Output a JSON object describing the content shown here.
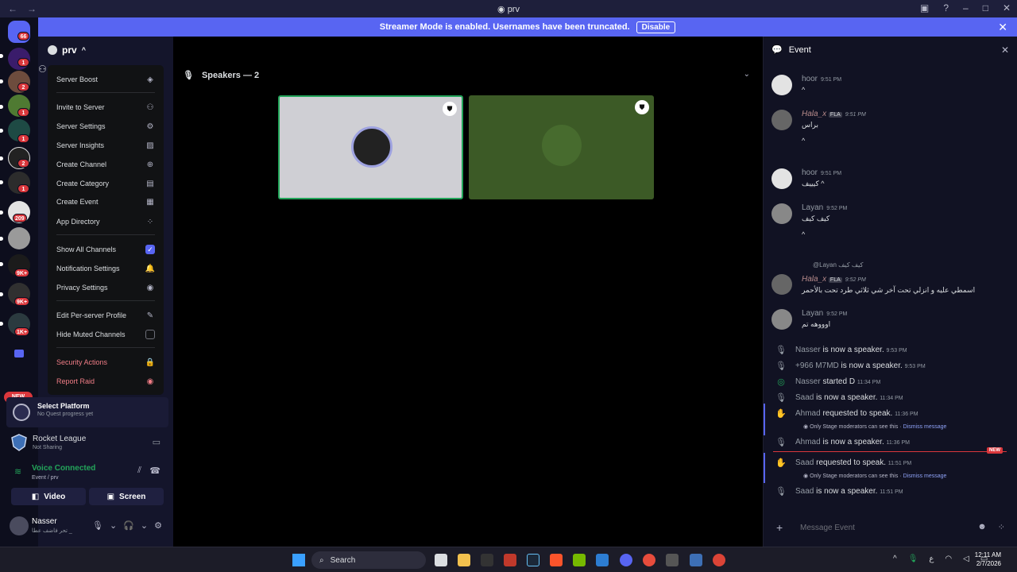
{
  "window": {
    "title": "prv",
    "back": "←",
    "forward": "→",
    "controls": [
      "▣",
      "?",
      "–",
      "□",
      "✕"
    ]
  },
  "server_rail": {
    "badges": [
      "66",
      "1",
      "2",
      "1",
      "1",
      "2",
      "1",
      "209",
      "9K+",
      "9K+",
      "1K+"
    ],
    "new_label": "NEW"
  },
  "banner": {
    "text": "Streamer Mode is enabled. Usernames have been truncated.",
    "button": "Disable",
    "close": "✕"
  },
  "sidebar": {
    "server_name": "prv",
    "menu": {
      "items": [
        {
          "label": "Server Boost",
          "icon": "◈"
        },
        {
          "label": "Invite to Server",
          "icon": "⚇"
        },
        {
          "label": "Server Settings",
          "icon": "⚙"
        },
        {
          "label": "Server Insights",
          "icon": "▨"
        },
        {
          "label": "Create Channel",
          "icon": "⊕"
        },
        {
          "label": "Create Category",
          "icon": "▤"
        },
        {
          "label": "Create Event",
          "icon": "▦"
        },
        {
          "label": "App Directory",
          "icon": "⁘"
        },
        {
          "label": "Show All Channels",
          "icon": "✓"
        },
        {
          "label": "Notification Settings",
          "icon": "🔔"
        },
        {
          "label": "Privacy Settings",
          "icon": "◉"
        },
        {
          "label": "Edit Per-server Profile",
          "icon": "✎"
        },
        {
          "label": "Hide Muted Channels",
          "icon": ""
        },
        {
          "label": "Security Actions",
          "icon": "🔒"
        },
        {
          "label": "Report Raid",
          "icon": "◉"
        }
      ]
    },
    "quest": {
      "title": "Select Platform",
      "subtitle": "No Quest progress yet"
    },
    "activity": {
      "title": "Rocket League",
      "subtitle": "Not Sharing"
    },
    "voice": {
      "status": "Voice Connected",
      "location": "Event / prv",
      "video_label": "Video",
      "screen_label": "Screen"
    },
    "user": {
      "name": "Nasser",
      "status": "تحر فاضف عطا _"
    }
  },
  "stage": {
    "title": "Speakers — 2"
  },
  "event_panel": {
    "title": "Event",
    "messages": [
      {
        "author": "hoor",
        "time": "9:51 PM",
        "lines": [
          "^"
        ]
      },
      {
        "author": "Hala_x",
        "tag": "FLA",
        "time": "9:51 PM",
        "lines": [
          "براس",
          "^"
        ]
      },
      {
        "author": "hoor",
        "time": "9:51 PM",
        "lines": [
          "كيييف ^"
        ]
      },
      {
        "author": "Layan",
        "time": "9:52 PM",
        "lines": [
          "كيف كيف",
          "^"
        ]
      },
      {
        "reply": "@Layan كيف كيف",
        "author": "Hala_x",
        "tag": "FLA",
        "time": "9:52 PM",
        "lines": [
          "اسمطي عليه و انزلي تحت آخر شي ثلاثي طرد تحت بالأحمر"
        ]
      },
      {
        "author": "Layan",
        "time": "9:52 PM",
        "lines": [
          "اوووهه تم"
        ]
      }
    ],
    "system": [
      {
        "who": "Nasser",
        "text": "is now a speaker.",
        "time": "9:53 PM"
      },
      {
        "who": "+966 M7MD",
        "text": "is now a speaker.",
        "time": "9:53 PM"
      },
      {
        "who": "Nasser",
        "text": "started D",
        "time": "11:34 PM"
      },
      {
        "who": "Saad",
        "text": "is now a speaker.",
        "time": "11:34 PM"
      },
      {
        "who": "Ahmad",
        "text": "requested to speak.",
        "time": "11:36 PM"
      },
      {
        "who": "Ahmad",
        "text": "is now a speaker.",
        "time": "11:36 PM"
      },
      {
        "who": "Saad",
        "text": "requested to speak.",
        "time": "11:51 PM"
      },
      {
        "who": "Saad",
        "text": "is now a speaker.",
        "time": "11:51 PM"
      }
    ],
    "mod_note": "Only Stage moderators can see this ·",
    "dismiss": "Dismiss message",
    "new_tag": "NEW",
    "composer_placeholder": "Message Event"
  },
  "taskbar": {
    "search": "Search",
    "time": "12:11 AM",
    "date": "2/7/2026",
    "lang": "ع"
  },
  "colors": {
    "accent": "#5865f2",
    "green": "#23a55a",
    "red": "#da373c",
    "tile1": "#cfcfd4",
    "tile2": "#3c5a26"
  }
}
